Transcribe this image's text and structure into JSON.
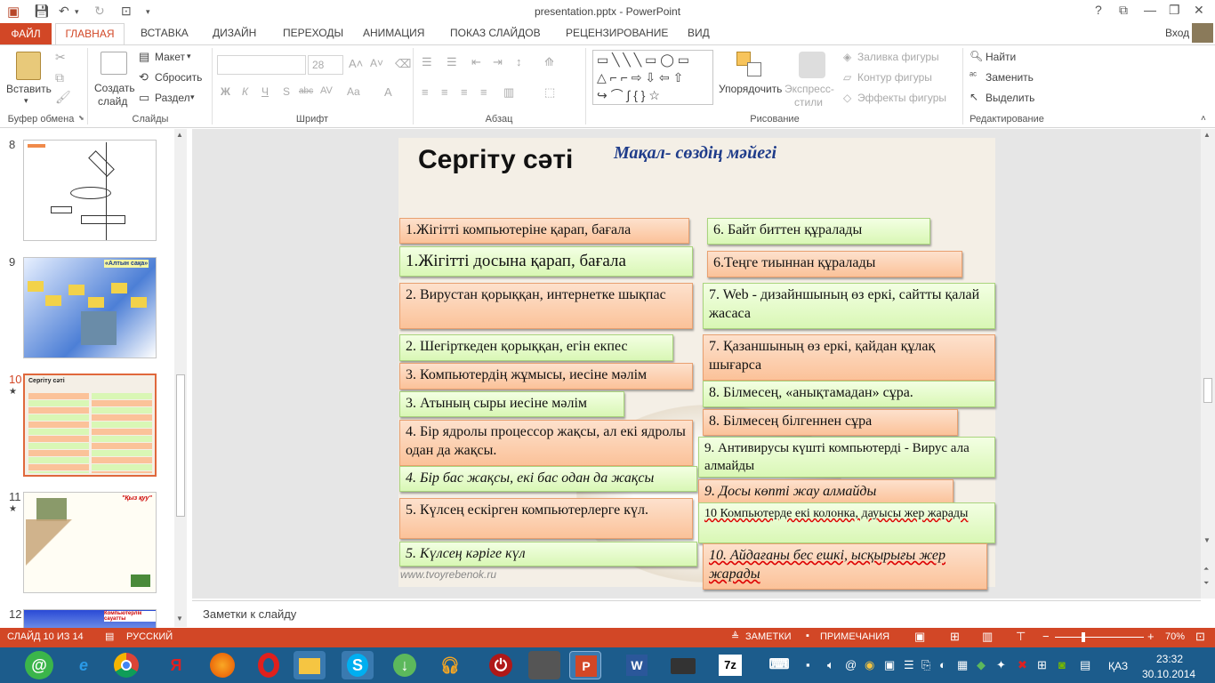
{
  "title_bar": {
    "title": "presentation.pptx - PowerPoint",
    "help": "?",
    "minimize": "—",
    "restore": "❐",
    "close": "✕",
    "ribbon_opts": "⧉"
  },
  "tabs": {
    "file": "ФАЙЛ",
    "home": "ГЛАВНАЯ",
    "insert": "ВСТАВКА",
    "design": "ДИЗАЙН",
    "transitions": "ПЕРЕХОДЫ",
    "animation": "АНИМАЦИЯ",
    "slideshow": "ПОКАЗ СЛАЙДОВ",
    "review": "РЕЦЕНЗИРОВАНИЕ",
    "view": "ВИД",
    "signin": "Вход"
  },
  "ribbon": {
    "clipboard": {
      "paste": "Вставить",
      "label": "Буфер обмена"
    },
    "slides": {
      "new_slide_1": "Создать",
      "new_slide_2": "слайд",
      "layout": "Макет",
      "reset": "Сбросить",
      "section": "Раздел",
      "label": "Слайды"
    },
    "font": {
      "size": "28",
      "bold": "Ж",
      "italic": "К",
      "underline": "Ч",
      "strike": "S",
      "spacing": "abc",
      "case": "AV",
      "aa": "Aa",
      "label": "Шрифт"
    },
    "paragraph": {
      "label": "Абзац"
    },
    "drawing": {
      "arrange_1": "Упорядочить",
      "styles_1": "Экспресс-",
      "styles_2": "стили",
      "fill": "Заливка фигуры",
      "outline": "Контур фигуры",
      "effects": "Эффекты фигуры",
      "label": "Рисование"
    },
    "editing": {
      "find": "Найти",
      "replace": "Заменить",
      "select": "Выделить",
      "label": "Редактирование"
    }
  },
  "thumbnails": [
    {
      "num": "8",
      "star": ""
    },
    {
      "num": "9",
      "star": ""
    },
    {
      "num": "10",
      "star": "★"
    },
    {
      "num": "11",
      "star": "★"
    },
    {
      "num": "12",
      "star": ""
    }
  ],
  "thumb_text": {
    "t9_title": "«Алтын сақа»",
    "t11_title": "\"Қыз қуу\"",
    "t12_title": "Компьютерлік сауатты"
  },
  "slide": {
    "title": "Сергіту сәті",
    "subtitle": "Мақал- сөздің мәйегі",
    "watermark": "www.tvoyrebenok.ru",
    "left": [
      "1.Жігітті компьютеріне қарап, бағала",
      "1.Жігітті досына қарап, бағала",
      "2. Вирустан қорыққан, интернетке шықпас",
      "2. Шегірткеден қорыққан, егін екпес",
      "3. Компьютердің жұмысы, иесіне мәлім",
      "3. Атының сыры иесіне мәлім",
      "4. Бір ядролы процессор жақсы, ал екі ядролы одан да жақсы.",
      "4. Бір бас жақсы, екі бас одан да жақсы",
      "5. Күлсең ескірген компьютерлерге күл.",
      "5. Күлсең кәріге күл"
    ],
    "right": [
      "6. Байт биттен құралады",
      "6.Теңге тиыннан құралады",
      "7. Web - дизайншының өз еркі, сайтты қалай жасаса",
      "7. Қазаншының өз еркі, қайдан құлақ шығарса",
      "8. Білмесең, «анықтамадан»  сұра.",
      "8. Білмесең білгеннен сұра",
      "9. Антивирусы күшті компьютерді - Вирус ала алмайды",
      "9. Досы көпті  жау алмайды",
      "10 Компьютерде екі колонка, дауысы жер жарады",
      "10. Айдағаны бес ешкі, ысқырығы жер жарады"
    ]
  },
  "notes": {
    "placeholder": "Заметки к слайду"
  },
  "status": {
    "slide": "СЛАЙД 10 ИЗ 14",
    "lang": "РУССКИЙ",
    "notes": "ЗАМЕТКИ",
    "comments": "ПРИМЕЧАНИЯ",
    "zoom": "70%"
  },
  "taskbar": {
    "lang": "ҚАЗ",
    "time": "23:32",
    "date": "30.10.2014"
  },
  "colors": {
    "accent": "#D24726",
    "taskbar": "#1C5C8C"
  }
}
